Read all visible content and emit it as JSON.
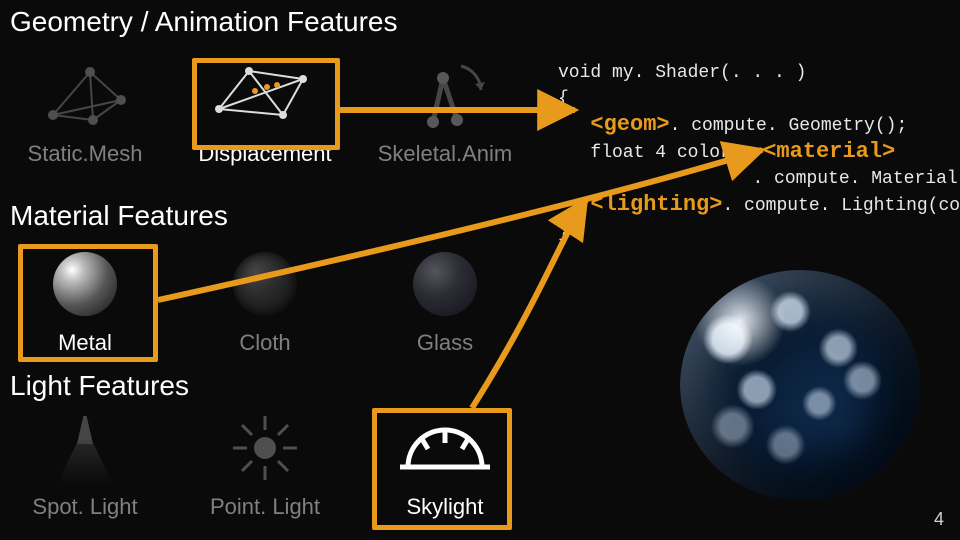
{
  "headings": {
    "geom": "Geometry / Animation Features",
    "material": "Material Features",
    "light": "Light Features"
  },
  "geom_features": [
    {
      "label": "Static.Mesh",
      "highlighted": false
    },
    {
      "label": "Displacement",
      "highlighted": true
    },
    {
      "label": "Skeletal.Anim",
      "highlighted": false
    }
  ],
  "material_features": [
    {
      "label": "Metal",
      "highlighted": true
    },
    {
      "label": "Cloth",
      "highlighted": false
    },
    {
      "label": "Glass",
      "highlighted": false
    }
  ],
  "light_features": [
    {
      "label": "Spot. Light",
      "highlighted": false
    },
    {
      "label": "Point. Light",
      "highlighted": false
    },
    {
      "label": "Skylight",
      "highlighted": true
    }
  ],
  "code": {
    "l1": "void my. Shader(. . . )",
    "l2": "{",
    "geom_kw": "<geom>",
    "geom_call": ". compute. Geometry();",
    "l4a": "   float 4 color = ",
    "mat_kw": "<material>",
    "mat_call": ". compute. Material();",
    "light_kw": "<lighting>",
    "light_call": ". compute. Lighting(color);",
    "l7": "}"
  },
  "page_number": "4",
  "colors": {
    "accent": "#e89a1c"
  }
}
